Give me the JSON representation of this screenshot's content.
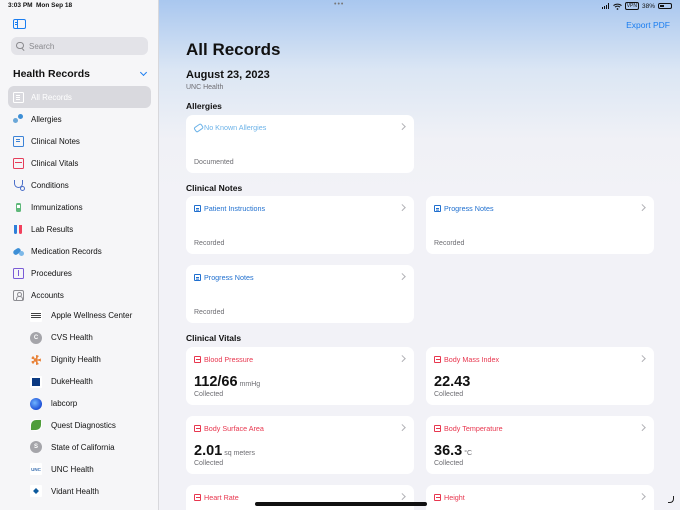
{
  "status_bar": {
    "time": "3:03 PM",
    "date": "Mon Sep 18",
    "vpn": "VPN",
    "battery": "38%"
  },
  "sidebar": {
    "search_placeholder": "Search",
    "section_title": "Health Records",
    "items": [
      {
        "label": "All Records",
        "icon": "document-icon",
        "selected": true
      },
      {
        "label": "Allergies",
        "icon": "allergies-icon"
      },
      {
        "label": "Clinical Notes",
        "icon": "clinical-notes-icon"
      },
      {
        "label": "Clinical Vitals",
        "icon": "clinical-vitals-icon"
      },
      {
        "label": "Conditions",
        "icon": "stethoscope-icon"
      },
      {
        "label": "Immunizations",
        "icon": "vaccine-icon"
      },
      {
        "label": "Lab Results",
        "icon": "test-tubes-icon"
      },
      {
        "label": "Medication Records",
        "icon": "pills-icon"
      },
      {
        "label": "Procedures",
        "icon": "procedures-icon"
      },
      {
        "label": "Accounts",
        "icon": "accounts-icon"
      }
    ],
    "accounts": [
      {
        "label": "Apple Wellness Center"
      },
      {
        "label": "CVS Health",
        "logo_letter": "C"
      },
      {
        "label": "Dignity Health"
      },
      {
        "label": "DukeHealth"
      },
      {
        "label": "labcorp"
      },
      {
        "label": "Quest Diagnostics"
      },
      {
        "label": "State of California",
        "logo_letter": "S"
      },
      {
        "label": "UNC Health",
        "logo_text": "UNC"
      },
      {
        "label": "Vidant Health"
      }
    ]
  },
  "main": {
    "export_label": "Export PDF",
    "title": "All Records",
    "date": "August 23, 2023",
    "provider": "UNC Health",
    "allergies": {
      "heading": "Allergies",
      "card": {
        "title": "No Known Allergies",
        "footer": "Documented"
      }
    },
    "clinical_notes": {
      "heading": "Clinical Notes",
      "cards": [
        {
          "title": "Patient Instructions",
          "footer": "Recorded"
        },
        {
          "title": "Progress Notes",
          "footer": "Recorded"
        },
        {
          "title": "Progress Notes",
          "footer": "Recorded"
        }
      ]
    },
    "clinical_vitals": {
      "heading": "Clinical Vitals",
      "cards": [
        {
          "title": "Blood Pressure",
          "value": "112/66",
          "unit": "mmHg",
          "footer": "Collected"
        },
        {
          "title": "Body Mass Index",
          "value": "22.43",
          "unit": "",
          "footer": "Collected"
        },
        {
          "title": "Body Surface Area",
          "value": "2.01",
          "unit": "sq meters",
          "footer": "Collected"
        },
        {
          "title": "Body Temperature",
          "value": "36.3",
          "unit": "°C",
          "footer": "Collected"
        },
        {
          "title": "Heart Rate"
        },
        {
          "title": "Height"
        }
      ]
    }
  },
  "colors": {
    "accent": "#1a7df0",
    "vitals": "#e8374f",
    "notes": "#1f6fcf",
    "allergy": "#6db3e8"
  }
}
